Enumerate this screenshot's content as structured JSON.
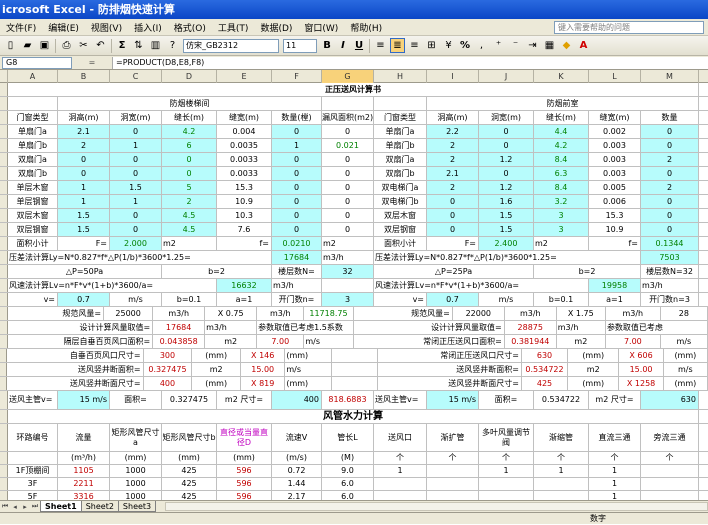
{
  "window": {
    "title": "icrosoft Excel - 防排烟快速计算"
  },
  "menu": [
    "文件(F)",
    "编辑(E)",
    "视图(V)",
    "插入(I)",
    "格式(O)",
    "工具(T)",
    "数据(D)",
    "窗口(W)",
    "帮助(H)"
  ],
  "help_placeholder": "键入需要帮助的问题",
  "toolbar": {
    "font": "仿宋_GB2312",
    "size": "11",
    "bold": "B",
    "italic": "I",
    "underline": "U",
    "sum": "Σ",
    "percent": "%"
  },
  "formula_bar": {
    "cell": "G8",
    "fx": "=",
    "formula": "=PRODUCT(D8,E8,F8)"
  },
  "columns": [
    "A",
    "B",
    "C",
    "D",
    "E",
    "F",
    "G",
    "H",
    "I",
    "J",
    "K",
    "L",
    "M"
  ],
  "selected_column": "G",
  "rows": [
    [
      [
        "正压送风计算书",
        13,
        "bold"
      ]
    ],
    [
      [
        "",
        1
      ],
      [
        "防烟楼梯间",
        5
      ],
      [
        "",
        1
      ],
      [
        "",
        1
      ],
      [
        "防烟前室",
        5
      ]
    ],
    [
      [
        "门窗类型",
        1
      ],
      [
        "洞高(m)",
        1
      ],
      [
        "洞宽(m)",
        1
      ],
      [
        "缝长(m)",
        1
      ],
      [
        "缝宽(m)",
        1
      ],
      [
        "数量(樘)",
        1
      ],
      [
        "漏风面积(m2)",
        1
      ],
      [
        "门窗类型",
        1
      ],
      [
        "洞高(m)",
        1
      ],
      [
        "洞宽(m)",
        1
      ],
      [
        "缝长(m)",
        1
      ],
      [
        "缝宽(m)",
        1
      ],
      [
        "数量",
        1
      ]
    ],
    [
      [
        "单扇门a",
        1
      ],
      [
        "2.1",
        1,
        "cyan"
      ],
      [
        "0",
        1,
        "cyan"
      ],
      [
        "4.2",
        1,
        "cyan green"
      ],
      [
        "0.004",
        1
      ],
      [
        "0",
        1,
        "cyan"
      ],
      [
        "0",
        1
      ],
      [
        "单扇门a",
        1
      ],
      [
        "2.2",
        1,
        "cyan"
      ],
      [
        "0",
        1,
        "cyan"
      ],
      [
        "4.4",
        1,
        "cyan green"
      ],
      [
        "0.002",
        1
      ],
      [
        "0",
        1,
        "cyan"
      ]
    ],
    [
      [
        "单扇门b",
        1
      ],
      [
        "2",
        1,
        "cyan"
      ],
      [
        "1",
        1,
        "cyan"
      ],
      [
        "6",
        1,
        "cyan green"
      ],
      [
        "0.0035",
        1
      ],
      [
        "1",
        1,
        "cyan"
      ],
      [
        "0.021",
        1,
        "green"
      ],
      [
        "单扇门b",
        1
      ],
      [
        "2",
        1,
        "cyan"
      ],
      [
        "0",
        1,
        "cyan"
      ],
      [
        "4.2",
        1,
        "cyan green"
      ],
      [
        "0.003",
        1
      ],
      [
        "0",
        1,
        "cyan"
      ]
    ],
    [
      [
        "双扇门a",
        1
      ],
      [
        "0",
        1,
        "cyan"
      ],
      [
        "0",
        1,
        "cyan"
      ],
      [
        "0",
        1,
        "cyan green"
      ],
      [
        "0.0033",
        1
      ],
      [
        "0",
        1,
        "cyan"
      ],
      [
        "0",
        1
      ],
      [
        "双扇门a",
        1
      ],
      [
        "2",
        1,
        "cyan"
      ],
      [
        "1.2",
        1,
        "cyan"
      ],
      [
        "8.4",
        1,
        "cyan green"
      ],
      [
        "0.003",
        1
      ],
      [
        "2",
        1,
        "cyan"
      ]
    ],
    [
      [
        "双扇门b",
        1
      ],
      [
        "0",
        1,
        "cyan"
      ],
      [
        "0",
        1,
        "cyan"
      ],
      [
        "0",
        1,
        "cyan green"
      ],
      [
        "0.0033",
        1
      ],
      [
        "0",
        1,
        "cyan"
      ],
      [
        "0",
        1
      ],
      [
        "双扇门b",
        1
      ],
      [
        "2.1",
        1,
        "cyan"
      ],
      [
        "0",
        1,
        "cyan"
      ],
      [
        "6.3",
        1,
        "cyan green"
      ],
      [
        "0.003",
        1
      ],
      [
        "0",
        1,
        "cyan"
      ]
    ],
    [
      [
        "单层木窗",
        1
      ],
      [
        "1",
        1,
        "cyan"
      ],
      [
        "1.5",
        1,
        "cyan"
      ],
      [
        "5",
        1,
        "cyan green"
      ],
      [
        "15.3",
        1
      ],
      [
        "0",
        1,
        "cyan"
      ],
      [
        "0",
        1
      ],
      [
        "双电梯门a",
        1
      ],
      [
        "2",
        1,
        "cyan"
      ],
      [
        "1.2",
        1,
        "cyan"
      ],
      [
        "8.4",
        1,
        "cyan green"
      ],
      [
        "0.005",
        1
      ],
      [
        "2",
        1,
        "cyan"
      ]
    ],
    [
      [
        "单层钢窗",
        1
      ],
      [
        "1",
        1,
        "cyan"
      ],
      [
        "1",
        1,
        "cyan"
      ],
      [
        "2",
        1,
        "cyan green"
      ],
      [
        "10.9",
        1
      ],
      [
        "0",
        1,
        "cyan"
      ],
      [
        "0",
        1
      ],
      [
        "双电梯门b",
        1
      ],
      [
        "0",
        1,
        "cyan"
      ],
      [
        "1.6",
        1,
        "cyan"
      ],
      [
        "3.2",
        1,
        "cyan green"
      ],
      [
        "0.006",
        1
      ],
      [
        "0",
        1,
        "cyan"
      ]
    ],
    [
      [
        "双层木窗",
        1
      ],
      [
        "1.5",
        1,
        "cyan"
      ],
      [
        "0",
        1,
        "cyan"
      ],
      [
        "4.5",
        1,
        "cyan green"
      ],
      [
        "10.3",
        1
      ],
      [
        "0",
        1,
        "cyan"
      ],
      [
        "0",
        1
      ],
      [
        "双层木窗",
        1
      ],
      [
        "0",
        1,
        "cyan"
      ],
      [
        "1.5",
        1,
        "cyan"
      ],
      [
        "3",
        1,
        "cyan green"
      ],
      [
        "15.3",
        1
      ],
      [
        "0",
        1,
        "cyan"
      ]
    ],
    [
      [
        "双层钢窗",
        1
      ],
      [
        "1.5",
        1,
        "cyan"
      ],
      [
        "0",
        1,
        "cyan"
      ],
      [
        "4.5",
        1,
        "cyan green"
      ],
      [
        "7.6",
        1
      ],
      [
        "0",
        1,
        "cyan"
      ],
      [
        "0",
        1
      ],
      [
        "双层钢窗",
        1
      ],
      [
        "0",
        1,
        "cyan"
      ],
      [
        "1.5",
        1,
        "cyan"
      ],
      [
        "3",
        1,
        "cyan green"
      ],
      [
        "10.9",
        1
      ],
      [
        "0",
        1,
        "cyan"
      ]
    ],
    [
      [
        "面积小计",
        1
      ],
      [
        "F=",
        1,
        "rgt"
      ],
      [
        "2.000",
        1,
        "cyan green"
      ],
      [
        "m2",
        1,
        "lft"
      ],
      [
        "f=",
        1,
        "rgt"
      ],
      [
        "0.0210",
        1,
        "cyan green"
      ],
      [
        "m2",
        1,
        "lft"
      ],
      [
        "面积小计",
        1
      ],
      [
        "F=",
        1,
        "rgt"
      ],
      [
        "2.400",
        1,
        "cyan green"
      ],
      [
        "m2",
        1,
        "lft"
      ],
      [
        "f=",
        1,
        "rgt"
      ],
      [
        "0.1344",
        1,
        "cyan green"
      ]
    ],
    [
      [
        "压差法计算Ly=N*0.827*f*△P(1/b)*3600*1.25=",
        5,
        "lft"
      ],
      [
        "17684",
        1,
        "cyan green"
      ],
      [
        "m3/h",
        1,
        "lft"
      ],
      [
        "压差法计算Ly=N*0.827*f*△P(1/b)*3600*1.25=",
        5,
        "lft"
      ],
      [
        "7503",
        1,
        "cyan green"
      ]
    ],
    [
      [
        "△P=50Pa",
        3
      ],
      [
        "b=2",
        2
      ],
      [
        "楼层数N=",
        1
      ],
      [
        "32",
        1,
        "cyan"
      ],
      [
        "△P=25Pa",
        3
      ],
      [
        "b=2",
        2
      ],
      [
        "楼层数N=32",
        1
      ]
    ],
    [
      [
        "风速法计算Lv=n*F*v*(1+b)*3600/a=",
        4,
        "lft"
      ],
      [
        "16632",
        1,
        "cyan green"
      ],
      [
        "m3/h",
        1,
        "lft"
      ],
      [
        "",
        1
      ],
      [
        "风速法计算Lv=n*F*v*(1+b)*3600/a=",
        4,
        "lft"
      ],
      [
        "19958",
        1,
        "cyan green"
      ],
      [
        "m3/h",
        1,
        "lft"
      ]
    ],
    [
      [
        "v=",
        1,
        "rgt"
      ],
      [
        "0.7",
        1,
        "cyan"
      ],
      [
        "m/s",
        1
      ],
      [
        "b=0.1",
        1
      ],
      [
        "a=1",
        1
      ],
      [
        "开门数n=",
        1
      ],
      [
        "3",
        1,
        "cyan"
      ],
      [
        "v=",
        1,
        "rgt"
      ],
      [
        "0.7",
        1,
        "cyan"
      ],
      [
        "m/s",
        1
      ],
      [
        "b=0.1",
        1
      ],
      [
        "a=1",
        1
      ],
      [
        "开门数n=3",
        1
      ]
    ],
    [
      [
        "规范风量=",
        2,
        "rgt"
      ],
      [
        "25000",
        1
      ],
      [
        "m3/h",
        1
      ],
      [
        "X 0.75",
        1
      ],
      [
        "m3/h",
        1
      ],
      [
        "11718.75",
        1,
        "green"
      ],
      [
        "规范风量=",
        2,
        "rgt"
      ],
      [
        "22000",
        1
      ],
      [
        "m3/h",
        1
      ],
      [
        "X 1.75",
        1
      ],
      [
        "m3/h",
        1
      ],
      [
        "28",
        1
      ]
    ],
    [
      [
        "设计计算风量取值=",
        3,
        "rgt"
      ],
      [
        "17684",
        1,
        "red"
      ],
      [
        "m3/h",
        1,
        "lft"
      ],
      [
        "参数取值已考虑1.5系数",
        2,
        "lft"
      ],
      [
        "设计计算风量取值=",
        3,
        "rgt"
      ],
      [
        "28875",
        1,
        "red"
      ],
      [
        "m3/h",
        1,
        "lft"
      ],
      [
        "参数取值已考虑",
        2,
        "lft"
      ]
    ],
    [
      [
        "隔层自垂百页风口面积=",
        3,
        "rgt"
      ],
      [
        "0.043858",
        1,
        "red"
      ],
      [
        "m2",
        1
      ],
      [
        "7.00",
        1,
        "red"
      ],
      [
        "m/s",
        1,
        "lft"
      ],
      [
        "常闭正压送风口面积=",
        3,
        "rgt"
      ],
      [
        "0.381944",
        1,
        "red"
      ],
      [
        "m2",
        1
      ],
      [
        "7.00",
        1,
        "red"
      ],
      [
        "m/s",
        1
      ]
    ],
    [
      [
        "自垂百页风口尺寸=",
        3,
        "rgt"
      ],
      [
        "300",
        1,
        "red"
      ],
      [
        "(mm)",
        1
      ],
      [
        "X 146",
        1,
        "red"
      ],
      [
        "(mm)",
        1,
        "lft"
      ],
      [
        "",
        1
      ],
      [
        "常闭正压送风口尺寸=",
        3,
        "rgt"
      ],
      [
        "630",
        1,
        "red"
      ],
      [
        "(mm)",
        1
      ],
      [
        "X 606",
        1,
        "red"
      ],
      [
        "(mm)",
        1
      ]
    ],
    [
      [
        "送风竖井断面积=",
        3,
        "rgt"
      ],
      [
        "0.327475",
        1,
        "red"
      ],
      [
        "m2",
        1
      ],
      [
        "15.00",
        1,
        "red"
      ],
      [
        "m/s",
        1,
        "lft"
      ],
      [
        "",
        1
      ],
      [
        "送风竖井断面积=",
        3,
        "rgt"
      ],
      [
        "0.534722",
        1,
        "red"
      ],
      [
        "m2",
        1
      ],
      [
        "15.00",
        1,
        "red"
      ],
      [
        "m/s",
        1
      ]
    ],
    [
      [
        "送风竖井断面尺寸=",
        3,
        "rgt"
      ],
      [
        "400",
        1,
        "red"
      ],
      [
        "(mm)",
        1
      ],
      [
        "X 819",
        1,
        "red"
      ],
      [
        "(mm)",
        1,
        "lft"
      ],
      [
        "",
        1
      ],
      [
        "送风竖井断面尺寸=",
        3,
        "rgt"
      ],
      [
        "425",
        1,
        "red"
      ],
      [
        "(mm)",
        1
      ],
      [
        "X 1258",
        1,
        "red"
      ],
      [
        "(mm)",
        1
      ]
    ]
  ],
  "big_row": [
    [
      "送风主管v=",
      1,
      "lft"
    ],
    [
      "15 m/s",
      1,
      "cyan rgt"
    ],
    [
      "面积=",
      1
    ],
    [
      "0.327475",
      1
    ],
    [
      "m2 尺寸=",
      1
    ],
    [
      "400",
      1,
      "cyan rgt"
    ],
    [
      "818.6883",
      1,
      "red"
    ],
    [
      "送风主管v=",
      1,
      "lft"
    ],
    [
      "15 m/s",
      1,
      "cyan rgt"
    ],
    [
      "面积=",
      1
    ],
    [
      "0.534722",
      1
    ],
    [
      "m2 尺寸=",
      1
    ],
    [
      "630",
      1,
      "cyan rgt"
    ]
  ],
  "section2_title": "风管水力计算",
  "hyd_headers": [
    "环路编号",
    "流量",
    "矩形风管尺寸a",
    "矩形风管尺寸b",
    "直径或当量直径D",
    "流速V",
    "管长L",
    "送风口",
    "渐扩管",
    "多叶风量调节阀",
    "渐缩管",
    "直流三通",
    "旁流三通",
    "总阻"
  ],
  "hyd_units": [
    "",
    "(m³/h)",
    "(mm)",
    "(mm)",
    "(mm)",
    "(m/s)",
    "(M)",
    "个",
    "个",
    "个",
    "个",
    "个",
    "个",
    ""
  ],
  "hyd_rows": [
    [
      "1F顶棚间",
      "1105",
      "1000",
      "425",
      "596",
      "0.72",
      "9.0",
      "1",
      "",
      "1",
      "1",
      "1",
      "",
      ""
    ],
    [
      "3F",
      "2211",
      "1000",
      "425",
      "596",
      "1.44",
      "6.0",
      "",
      "",
      "",
      "",
      "1",
      "",
      ""
    ],
    [
      "5F",
      "3316",
      "1000",
      "425",
      "596",
      "2.17",
      "6.0",
      "",
      "",
      "",
      "",
      "1",
      "",
      ""
    ]
  ],
  "sheets": [
    "Sheet1",
    "Sheet2",
    "Sheet3"
  ],
  "active_sheet": "Sheet1",
  "status": "数字"
}
